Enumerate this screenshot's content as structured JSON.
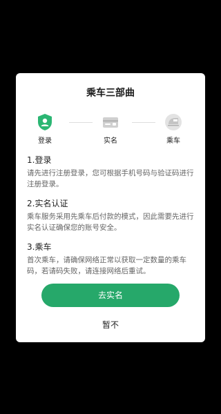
{
  "dialog": {
    "title": "乘车三部曲",
    "steps": [
      {
        "label": "登录",
        "icon": "shield-user-icon"
      },
      {
        "label": "实名",
        "icon": "id-card-icon"
      },
      {
        "label": "乘车",
        "icon": "train-icon"
      }
    ],
    "sections": [
      {
        "heading": "1.登录",
        "body": "请先进行注册登录，您可根据手机号码与验证码进行注册登录。"
      },
      {
        "heading": "2.实名认证",
        "body": "乘车服务采用先乘车后付款的模式，因此需要先进行实名认证确保您的账号安全。"
      },
      {
        "heading": "3.乘车",
        "body": "首次乘车，请确保网络正常以获取一定数量的乘车码，若请码失败，请连接网络后重试。"
      }
    ],
    "primary_button": "去实名",
    "secondary_button": "暂不"
  },
  "colors": {
    "accent": "#26a86a",
    "overlay": "#000000",
    "dialog_bg": "#ffffff"
  }
}
